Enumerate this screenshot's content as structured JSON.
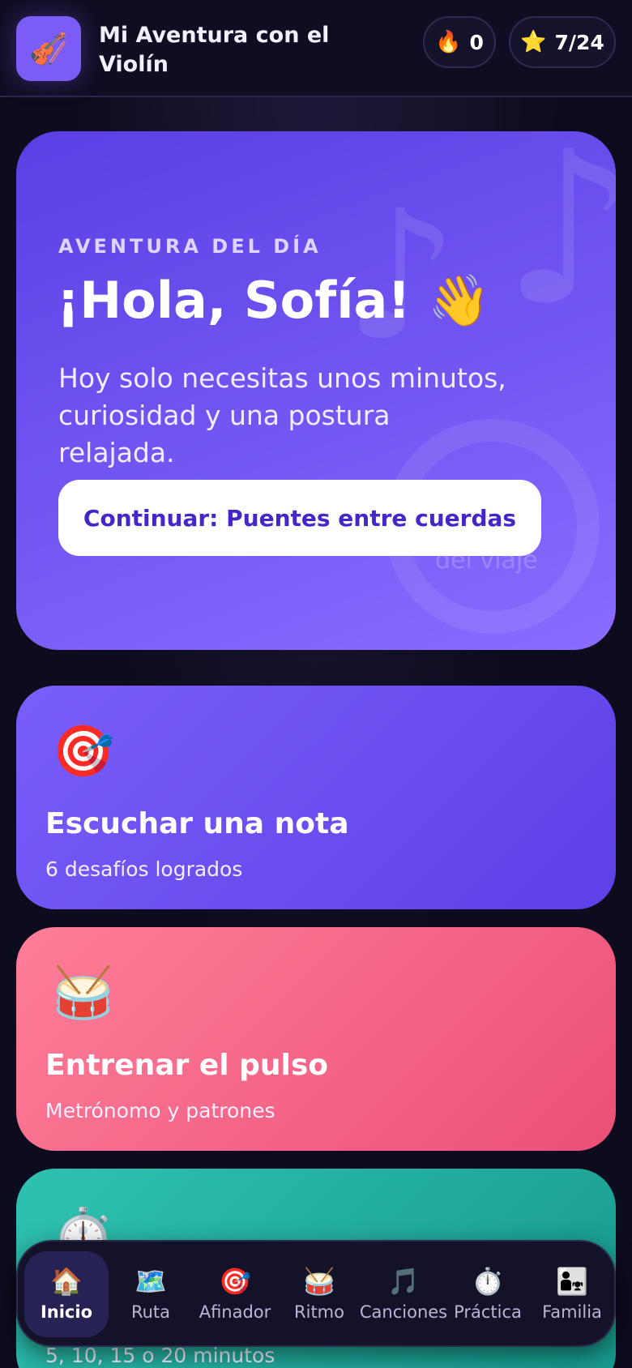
{
  "header": {
    "app_icon": "violin-icon",
    "title": "Mi Aventura con el Violín",
    "streak": {
      "icon": "fire-icon",
      "value": "0"
    },
    "stars": {
      "icon": "star-icon",
      "value": "7/24"
    }
  },
  "hero": {
    "kicker": "AVENTURA DEL DÍA",
    "greeting": "¡Hola, Sofía! 👋",
    "subtitle": "Hoy solo necesitas unos minutos, curiosidad y una postura relajada.",
    "cta_label": "Continuar: Puentes entre cuerdas",
    "ring_label": "del viaje"
  },
  "cards": {
    "listen": {
      "icon": "🎯",
      "title": "Escuchar una nota",
      "subtitle": "6 desafíos logrados"
    },
    "pulse": {
      "icon": "🥁",
      "title": "Entrenar el pulso",
      "subtitle": "Metrónomo y patrones"
    },
    "practice": {
      "icon": "⏱️",
      "subtitle": "5, 10, 15 o 20 minutos"
    }
  },
  "nav": {
    "items": [
      {
        "icon": "🏠",
        "label": "Inicio"
      },
      {
        "icon": "🗺️",
        "label": "Ruta"
      },
      {
        "icon": "🎯",
        "label": "Afinador"
      },
      {
        "icon": "🥁",
        "label": "Ritmo"
      },
      {
        "icon": "🎵",
        "label": "Canciones"
      },
      {
        "icon": "⏱️",
        "label": "Práctica"
      },
      {
        "icon": "👨‍👧",
        "label": "Familia"
      }
    ],
    "active": "Inicio"
  },
  "colors": {
    "background": "#0d0b1e",
    "hero": "#6b4ef0",
    "cta_text": "#4527c9",
    "card_listen": "#6a4cf2",
    "card_pulse": "#f5678a",
    "card_practice": "#22ad9f"
  }
}
